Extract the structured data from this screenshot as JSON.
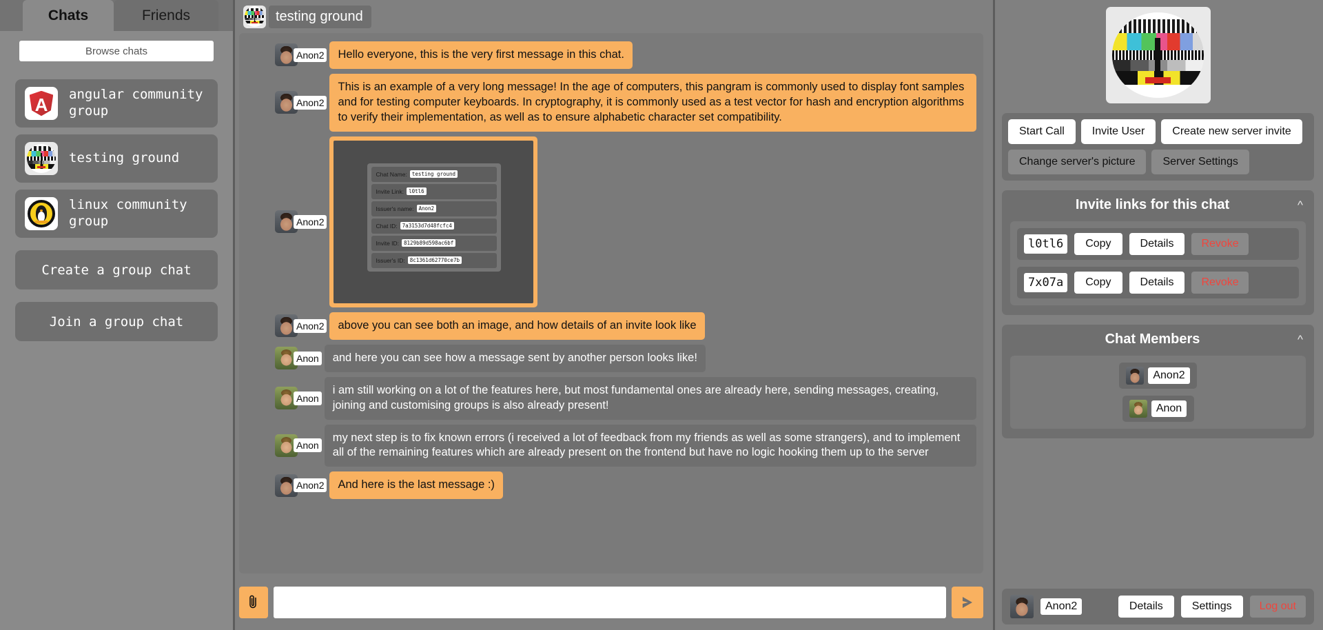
{
  "sidebar": {
    "tabs": [
      {
        "label": "Chats",
        "active": true
      },
      {
        "label": "Friends",
        "active": false
      }
    ],
    "browse_label": "Browse chats",
    "chats": [
      {
        "name": "angular community group",
        "icon": "angular-logo-icon"
      },
      {
        "name": "testing ground",
        "icon": "test-card-icon"
      },
      {
        "name": "linux community group",
        "icon": "linux-tux-icon"
      }
    ],
    "create_group_label": "Create a group chat",
    "join_group_label": "Join a group chat"
  },
  "chat": {
    "title": "testing ground",
    "title_icon": "test-card-icon",
    "messages": [
      {
        "author": "Anon2",
        "own": true,
        "type": "text",
        "text": "Hello everyone, this is the very first message in this chat."
      },
      {
        "author": "Anon2",
        "own": true,
        "type": "text",
        "text": "This is an example of a very long message! In the age of computers, this pangram is commonly used to display font samples and for testing computer keyboards. In cryptography, it is commonly used as a test vector for hash and encryption algorithms to verify their implementation, as well as to ensure alphabetic character set compatibility."
      },
      {
        "author": "Anon2",
        "own": true,
        "type": "image"
      },
      {
        "author": "Anon2",
        "own": true,
        "type": "text",
        "text": "above you can see both an image, and how details of an invite look like"
      },
      {
        "author": "Anon",
        "own": false,
        "type": "text",
        "text": "and here you can see how a message sent by another person looks like!"
      },
      {
        "author": "Anon",
        "own": false,
        "type": "text",
        "text": "i am still working on a lot of the features here, but most fundamental ones are already here, sending messages, creating, joining and customising groups is also already present!"
      },
      {
        "author": "Anon",
        "own": false,
        "type": "text",
        "text": "my next step is to fix known errors (i received a lot of feedback from my friends as well as some strangers), and to implement all of the remaining features which are already present on the frontend but have no logic hooking them up to the server"
      },
      {
        "author": "Anon2",
        "own": true,
        "type": "text",
        "text": "And here is the last message :)"
      }
    ],
    "embedded_invite": {
      "rows": [
        {
          "label": "Chat Name:",
          "value": "testing ground"
        },
        {
          "label": "Invite Link:",
          "value": "l0tl6"
        },
        {
          "label": "Issuer's name:",
          "value": "Anon2"
        },
        {
          "label": "Chat ID:",
          "value": "7a3153d7d48fcfc4"
        },
        {
          "label": "Invite ID:",
          "value": "8129b89d598ac6bf"
        },
        {
          "label": "Issuer's ID:",
          "value": "8c1361d62770ce7b"
        }
      ]
    }
  },
  "composer": {
    "attach_icon": "paperclip-icon",
    "input_value": "",
    "input_placeholder": "",
    "send_icon": "send-arrow-icon"
  },
  "right": {
    "server_picture_icon": "test-card-icon",
    "actions": [
      {
        "label": "Start Call",
        "style": "white"
      },
      {
        "label": "Invite User",
        "style": "white"
      },
      {
        "label": "Create new server invite",
        "style": "white"
      },
      {
        "label": "Change server's picture",
        "style": "grey"
      },
      {
        "label": "Server Settings",
        "style": "grey"
      }
    ],
    "invites_section": {
      "title": "Invite links for this chat",
      "collapse_icon": "chevron-up-icon",
      "copy_label": "Copy",
      "details_label": "Details",
      "revoke_label": "Revoke",
      "items": [
        {
          "code": "l0tl6"
        },
        {
          "code": "7x07a"
        }
      ]
    },
    "members_section": {
      "title": "Chat Members",
      "collapse_icon": "chevron-up-icon",
      "members": [
        {
          "name": "Anon2",
          "avatar": "avatar-anon2"
        },
        {
          "name": "Anon",
          "avatar": "avatar-anon"
        }
      ]
    },
    "profile": {
      "name": "Anon2",
      "avatar": "avatar-anon2",
      "details_label": "Details",
      "settings_label": "Settings",
      "logout_label": "Log out"
    }
  },
  "colors": {
    "accent_orange": "#f9b160",
    "panel_grey": "#6f6f6f",
    "bg_grey": "#808080",
    "danger_red": "#f0453d"
  }
}
